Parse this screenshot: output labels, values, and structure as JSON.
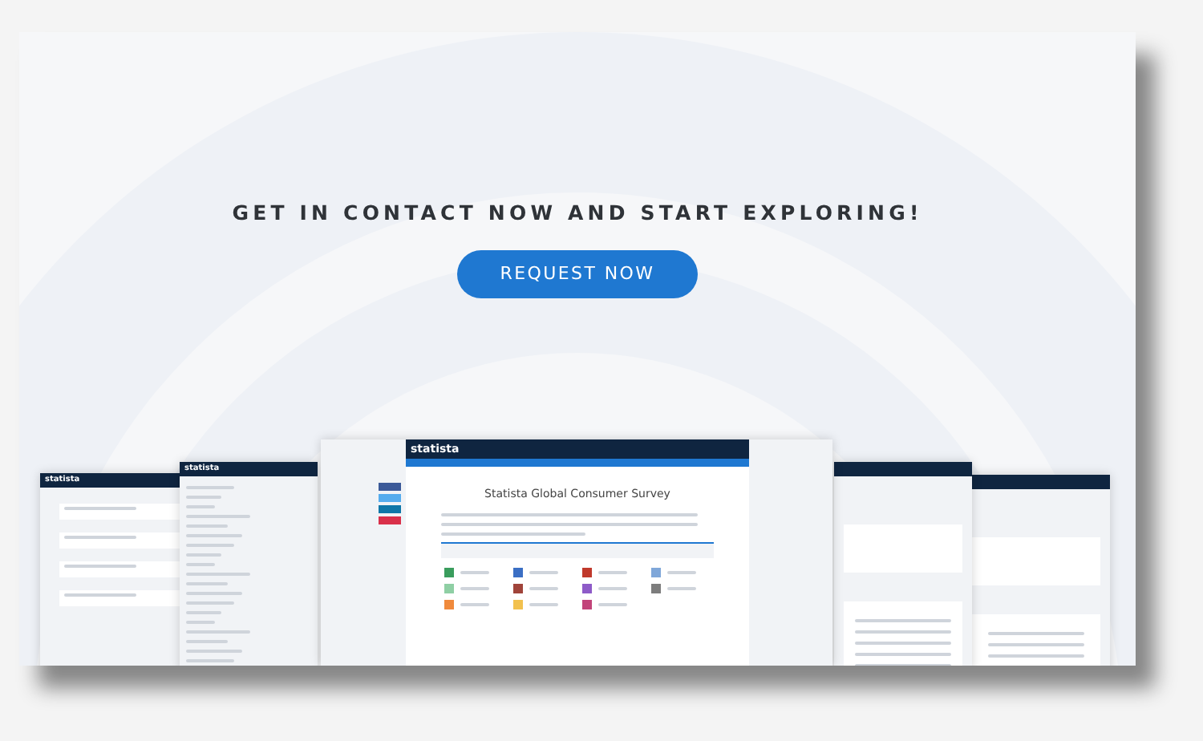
{
  "banner": {
    "headline": "GET IN CONTACT NOW AND START EXPLORING!",
    "button": "REQUEST NOW"
  },
  "preview": {
    "center": {
      "logo": "statista",
      "title": "Statista Global Consumer Survey",
      "categories": [
        {
          "color": "#3a9d5d"
        },
        {
          "color": "#3b6fc4"
        },
        {
          "color": "#c0392b"
        },
        {
          "color": "#7fa7d9"
        },
        {
          "color": "#8fcfa4"
        },
        {
          "color": "#a0443a"
        },
        {
          "color": "#8e5bc8"
        },
        {
          "color": "#7d7d7d"
        },
        {
          "color": "#f08a3c"
        },
        {
          "color": "#f2c14e"
        },
        {
          "color": "#c2447a"
        }
      ]
    },
    "side_windows": [
      {
        "logo": "statista"
      },
      {
        "logo": "statista"
      }
    ]
  }
}
